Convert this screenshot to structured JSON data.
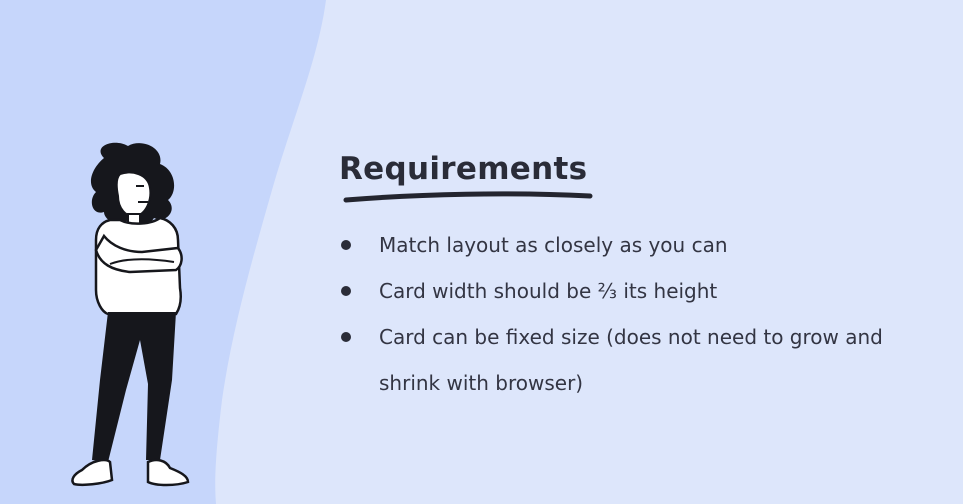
{
  "slide": {
    "title": "Requirements",
    "bullets": [
      "Match layout as closely as you can",
      "Card width should be ⅔ its height",
      "Card can be fixed size (does not need to grow and shrink with browser)"
    ]
  },
  "colors": {
    "background": "#dde6fb",
    "left_panel": "#c6d6fb",
    "text": "#333543"
  },
  "illustration": "woman-arms-crossed-illustration"
}
